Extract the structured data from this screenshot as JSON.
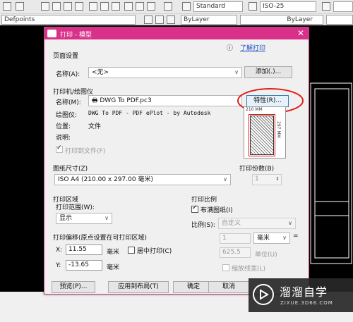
{
  "toolbar": {
    "text_style": "Standard",
    "dim_style": "ISO-25",
    "layer_name": "Defpoints",
    "linetype_left": "ByLayer",
    "linetype_right": "ByLayer"
  },
  "dialog": {
    "title": "打印 - 模型",
    "help_link": "了解打印",
    "page_setup": {
      "group": "页面设置",
      "name_label": "名称(A):",
      "name_value": "<无>",
      "add_button": "添加(.)..."
    },
    "printer": {
      "group": "打印机/绘图仪",
      "name_label": "名称(M):",
      "name_value": "DWG To PDF.pc3",
      "properties_button": "特性(R)...",
      "plotter_label": "绘图仪:",
      "plotter_value": "DWG To PDF - PDF ePlot - by Autodesk",
      "location_label": "位置:",
      "location_value": "文件",
      "desc_label": "说明:",
      "print_to_file": "打印到文件(F)",
      "preview_width": "210 MM",
      "preview_height": "297 MM"
    },
    "paper_size": {
      "group": "图纸尺寸(Z)",
      "value": "ISO A4 (210.00 x 297.00 毫米)"
    },
    "copies": {
      "group": "打印份数(B)",
      "value": "1"
    },
    "plot_area": {
      "group": "打印区域",
      "range_label": "打印范围(W):",
      "range_value": "显示"
    },
    "plot_offset": {
      "group": "打印偏移(原点设置在可打印区域)",
      "x_label": "X:",
      "x_value": "11.55",
      "x_unit": "毫米",
      "y_label": "Y:",
      "y_value": "-13.65",
      "y_unit": "毫米",
      "center_label": "居中打印(C)"
    },
    "plot_scale": {
      "group": "打印比例",
      "fit_label": "布满图纸(I)",
      "scale_label": "比例(S):",
      "scale_value": "自定义",
      "value1": "1",
      "unit": "毫米",
      "equals": "=",
      "value2": "625.5",
      "unit2": "单位(U)",
      "lineweight": "缩放线宽(L)"
    },
    "buttons": {
      "preview": "预览(P)...",
      "apply": "应用到布局(T)",
      "ok": "确定",
      "cancel": "取消"
    }
  },
  "watermark": {
    "main": "溜溜自学",
    "sub": "ZIXUE.3D66.COM"
  }
}
